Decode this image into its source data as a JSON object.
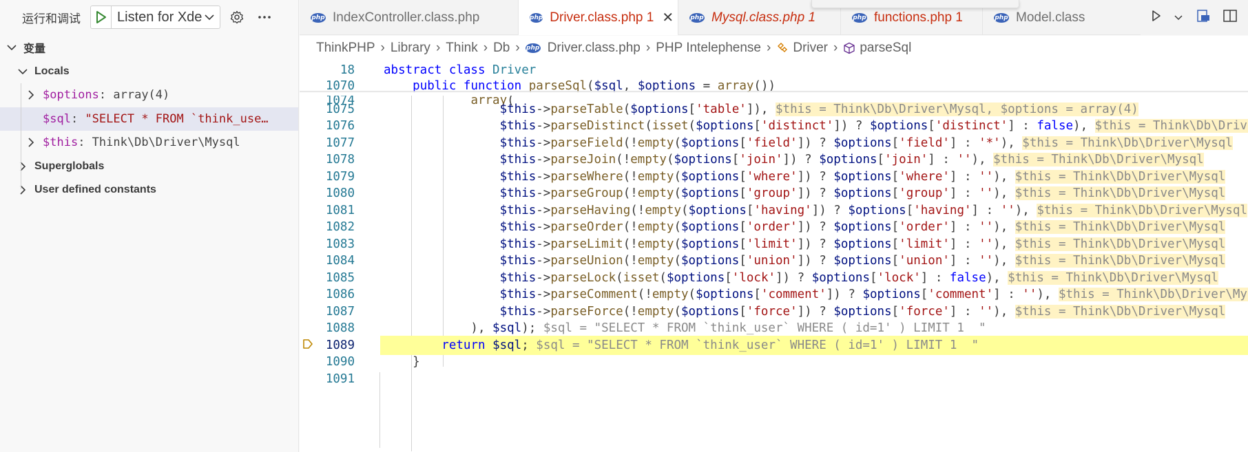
{
  "sidebar": {
    "title": "运行和调试",
    "launch_config": "Listen for Xde",
    "section_title": "变量",
    "locals_label": "Locals",
    "locals": [
      {
        "name": "$options",
        "value": "array(4)"
      },
      {
        "name": "$sql",
        "value": "\"SELECT * FROM `think_use…"
      },
      {
        "name": "$this",
        "value": "Think\\Db\\Driver\\Mysql"
      }
    ],
    "superglobals_label": "Superglobals",
    "user_constants_label": "User defined constants"
  },
  "tabs": [
    {
      "label": "IndexController.class.php"
    },
    {
      "label": "Driver.class.php 1"
    },
    {
      "label": "Mysql.class.php 1"
    },
    {
      "label": "functions.php 1"
    },
    {
      "label": "Model.class"
    }
  ],
  "breadcrumb": [
    "ThinkPHP",
    "Library",
    "Think",
    "Db",
    "Driver.class.php",
    "PHP Intelephense",
    "Driver",
    "parseSql"
  ],
  "editor": {
    "lines": [
      {
        "n": "18",
        "parts": [
          [
            "kw",
            "abstract "
          ],
          [
            "kw",
            "class "
          ],
          [
            "cls",
            "Driver"
          ]
        ]
      },
      {
        "n": "1070",
        "parts": [
          [
            "op",
            "    "
          ],
          [
            "kw",
            "public "
          ],
          [
            "kw",
            "function "
          ],
          [
            "fn",
            "parseSql"
          ],
          [
            "op",
            "("
          ],
          [
            "var",
            "$sql"
          ],
          [
            "op",
            ", "
          ],
          [
            "var",
            "$options"
          ],
          [
            "op",
            " = "
          ],
          [
            "fn",
            "array"
          ],
          [
            "op",
            "())"
          ]
        ]
      },
      {
        "n": "1074",
        "parts": [
          [
            "op",
            "            "
          ],
          [
            "fn",
            "array"
          ],
          [
            "op",
            "("
          ]
        ]
      },
      {
        "n": "1075",
        "parts": [
          [
            "op",
            "                "
          ],
          [
            "var",
            "$this"
          ],
          [
            "op",
            "->"
          ],
          [
            "fn",
            "parseTable"
          ],
          [
            "op",
            "("
          ],
          [
            "var",
            "$options"
          ],
          [
            "op",
            "["
          ],
          [
            "str",
            "'table'"
          ],
          [
            "op",
            "]), "
          ]
        ],
        "inline": "$this = Think\\Db\\Driver\\Mysql, $options = array(4)"
      },
      {
        "n": "1076",
        "parts": [
          [
            "op",
            "                "
          ],
          [
            "var",
            "$this"
          ],
          [
            "op",
            "->"
          ],
          [
            "fn",
            "parseDistinct"
          ],
          [
            "op",
            "("
          ],
          [
            "fn",
            "isset"
          ],
          [
            "op",
            "("
          ],
          [
            "var",
            "$options"
          ],
          [
            "op",
            "["
          ],
          [
            "str",
            "'distinct'"
          ],
          [
            "op",
            "]) ? "
          ],
          [
            "var",
            "$options"
          ],
          [
            "op",
            "["
          ],
          [
            "str",
            "'distinct'"
          ],
          [
            "op",
            "] : "
          ],
          [
            "kw",
            "false"
          ],
          [
            "op",
            "), "
          ]
        ],
        "inline": "$this = Think\\Db\\Driver\\Mysql"
      },
      {
        "n": "1077",
        "parts": [
          [
            "op",
            "                "
          ],
          [
            "var",
            "$this"
          ],
          [
            "op",
            "->"
          ],
          [
            "fn",
            "parseField"
          ],
          [
            "op",
            "(!"
          ],
          [
            "fn",
            "empty"
          ],
          [
            "op",
            "("
          ],
          [
            "var",
            "$options"
          ],
          [
            "op",
            "["
          ],
          [
            "str",
            "'field'"
          ],
          [
            "op",
            "]) ? "
          ],
          [
            "var",
            "$options"
          ],
          [
            "op",
            "["
          ],
          [
            "str",
            "'field'"
          ],
          [
            "op",
            "] : "
          ],
          [
            "str",
            "'*'"
          ],
          [
            "op",
            "), "
          ]
        ],
        "inline": "$this = Think\\Db\\Driver\\Mysql"
      },
      {
        "n": "1078",
        "parts": [
          [
            "op",
            "                "
          ],
          [
            "var",
            "$this"
          ],
          [
            "op",
            "->"
          ],
          [
            "fn",
            "parseJoin"
          ],
          [
            "op",
            "(!"
          ],
          [
            "fn",
            "empty"
          ],
          [
            "op",
            "("
          ],
          [
            "var",
            "$options"
          ],
          [
            "op",
            "["
          ],
          [
            "str",
            "'join'"
          ],
          [
            "op",
            "]) ? "
          ],
          [
            "var",
            "$options"
          ],
          [
            "op",
            "["
          ],
          [
            "str",
            "'join'"
          ],
          [
            "op",
            "] : "
          ],
          [
            "str",
            "''"
          ],
          [
            "op",
            "), "
          ]
        ],
        "inline": "$this = Think\\Db\\Driver\\Mysql"
      },
      {
        "n": "1079",
        "parts": [
          [
            "op",
            "                "
          ],
          [
            "var",
            "$this"
          ],
          [
            "op",
            "->"
          ],
          [
            "fn",
            "parseWhere"
          ],
          [
            "op",
            "(!"
          ],
          [
            "fn",
            "empty"
          ],
          [
            "op",
            "("
          ],
          [
            "var",
            "$options"
          ],
          [
            "op",
            "["
          ],
          [
            "str",
            "'where'"
          ],
          [
            "op",
            "]) ? "
          ],
          [
            "var",
            "$options"
          ],
          [
            "op",
            "["
          ],
          [
            "str",
            "'where'"
          ],
          [
            "op",
            "] : "
          ],
          [
            "str",
            "''"
          ],
          [
            "op",
            "), "
          ]
        ],
        "inline": "$this = Think\\Db\\Driver\\Mysql"
      },
      {
        "n": "1080",
        "parts": [
          [
            "op",
            "                "
          ],
          [
            "var",
            "$this"
          ],
          [
            "op",
            "->"
          ],
          [
            "fn",
            "parseGroup"
          ],
          [
            "op",
            "(!"
          ],
          [
            "fn",
            "empty"
          ],
          [
            "op",
            "("
          ],
          [
            "var",
            "$options"
          ],
          [
            "op",
            "["
          ],
          [
            "str",
            "'group'"
          ],
          [
            "op",
            "]) ? "
          ],
          [
            "var",
            "$options"
          ],
          [
            "op",
            "["
          ],
          [
            "str",
            "'group'"
          ],
          [
            "op",
            "] : "
          ],
          [
            "str",
            "''"
          ],
          [
            "op",
            "), "
          ]
        ],
        "inline": "$this = Think\\Db\\Driver\\Mysql"
      },
      {
        "n": "1081",
        "parts": [
          [
            "op",
            "                "
          ],
          [
            "var",
            "$this"
          ],
          [
            "op",
            "->"
          ],
          [
            "fn",
            "parseHaving"
          ],
          [
            "op",
            "(!"
          ],
          [
            "fn",
            "empty"
          ],
          [
            "op",
            "("
          ],
          [
            "var",
            "$options"
          ],
          [
            "op",
            "["
          ],
          [
            "str",
            "'having'"
          ],
          [
            "op",
            "]) ? "
          ],
          [
            "var",
            "$options"
          ],
          [
            "op",
            "["
          ],
          [
            "str",
            "'having'"
          ],
          [
            "op",
            "] : "
          ],
          [
            "str",
            "''"
          ],
          [
            "op",
            "), "
          ]
        ],
        "inline": "$this = Think\\Db\\Driver\\Mysql"
      },
      {
        "n": "1082",
        "parts": [
          [
            "op",
            "                "
          ],
          [
            "var",
            "$this"
          ],
          [
            "op",
            "->"
          ],
          [
            "fn",
            "parseOrder"
          ],
          [
            "op",
            "(!"
          ],
          [
            "fn",
            "empty"
          ],
          [
            "op",
            "("
          ],
          [
            "var",
            "$options"
          ],
          [
            "op",
            "["
          ],
          [
            "str",
            "'order'"
          ],
          [
            "op",
            "]) ? "
          ],
          [
            "var",
            "$options"
          ],
          [
            "op",
            "["
          ],
          [
            "str",
            "'order'"
          ],
          [
            "op",
            "] : "
          ],
          [
            "str",
            "''"
          ],
          [
            "op",
            "), "
          ]
        ],
        "inline": "$this = Think\\Db\\Driver\\Mysql"
      },
      {
        "n": "1083",
        "parts": [
          [
            "op",
            "                "
          ],
          [
            "var",
            "$this"
          ],
          [
            "op",
            "->"
          ],
          [
            "fn",
            "parseLimit"
          ],
          [
            "op",
            "(!"
          ],
          [
            "fn",
            "empty"
          ],
          [
            "op",
            "("
          ],
          [
            "var",
            "$options"
          ],
          [
            "op",
            "["
          ],
          [
            "str",
            "'limit'"
          ],
          [
            "op",
            "]) ? "
          ],
          [
            "var",
            "$options"
          ],
          [
            "op",
            "["
          ],
          [
            "str",
            "'limit'"
          ],
          [
            "op",
            "] : "
          ],
          [
            "str",
            "''"
          ],
          [
            "op",
            "), "
          ]
        ],
        "inline": "$this = Think\\Db\\Driver\\Mysql"
      },
      {
        "n": "1084",
        "parts": [
          [
            "op",
            "                "
          ],
          [
            "var",
            "$this"
          ],
          [
            "op",
            "->"
          ],
          [
            "fn",
            "parseUnion"
          ],
          [
            "op",
            "(!"
          ],
          [
            "fn",
            "empty"
          ],
          [
            "op",
            "("
          ],
          [
            "var",
            "$options"
          ],
          [
            "op",
            "["
          ],
          [
            "str",
            "'union'"
          ],
          [
            "op",
            "]) ? "
          ],
          [
            "var",
            "$options"
          ],
          [
            "op",
            "["
          ],
          [
            "str",
            "'union'"
          ],
          [
            "op",
            "] : "
          ],
          [
            "str",
            "''"
          ],
          [
            "op",
            "), "
          ]
        ],
        "inline": "$this = Think\\Db\\Driver\\Mysql"
      },
      {
        "n": "1085",
        "parts": [
          [
            "op",
            "                "
          ],
          [
            "var",
            "$this"
          ],
          [
            "op",
            "->"
          ],
          [
            "fn",
            "parseLock"
          ],
          [
            "op",
            "("
          ],
          [
            "fn",
            "isset"
          ],
          [
            "op",
            "("
          ],
          [
            "var",
            "$options"
          ],
          [
            "op",
            "["
          ],
          [
            "str",
            "'lock'"
          ],
          [
            "op",
            "]) ? "
          ],
          [
            "var",
            "$options"
          ],
          [
            "op",
            "["
          ],
          [
            "str",
            "'lock'"
          ],
          [
            "op",
            "] : "
          ],
          [
            "kw",
            "false"
          ],
          [
            "op",
            "), "
          ]
        ],
        "inline": "$this = Think\\Db\\Driver\\Mysql"
      },
      {
        "n": "1086",
        "parts": [
          [
            "op",
            "                "
          ],
          [
            "var",
            "$this"
          ],
          [
            "op",
            "->"
          ],
          [
            "fn",
            "parseComment"
          ],
          [
            "op",
            "(!"
          ],
          [
            "fn",
            "empty"
          ],
          [
            "op",
            "("
          ],
          [
            "var",
            "$options"
          ],
          [
            "op",
            "["
          ],
          [
            "str",
            "'comment'"
          ],
          [
            "op",
            "]) ? "
          ],
          [
            "var",
            "$options"
          ],
          [
            "op",
            "["
          ],
          [
            "str",
            "'comment'"
          ],
          [
            "op",
            "] : "
          ],
          [
            "str",
            "''"
          ],
          [
            "op",
            "), "
          ]
        ],
        "inline": "$this = Think\\Db\\Driver\\Mysql"
      },
      {
        "n": "1087",
        "parts": [
          [
            "op",
            "                "
          ],
          [
            "var",
            "$this"
          ],
          [
            "op",
            "->"
          ],
          [
            "fn",
            "parseForce"
          ],
          [
            "op",
            "(!"
          ],
          [
            "fn",
            "empty"
          ],
          [
            "op",
            "("
          ],
          [
            "var",
            "$options"
          ],
          [
            "op",
            "["
          ],
          [
            "str",
            "'force'"
          ],
          [
            "op",
            "]) ? "
          ],
          [
            "var",
            "$options"
          ],
          [
            "op",
            "["
          ],
          [
            "str",
            "'force'"
          ],
          [
            "op",
            "] : "
          ],
          [
            "str",
            "''"
          ],
          [
            "op",
            "), "
          ]
        ],
        "inline": "$this = Think\\Db\\Driver\\Mysql"
      },
      {
        "n": "1088",
        "parts": [
          [
            "op",
            "            ), "
          ],
          [
            "var",
            "$sql"
          ],
          [
            "op",
            "); "
          ]
        ],
        "inline_plain": "$sql = \"SELECT * FROM `think_user` WHERE ( id=1' ) LIMIT 1  \""
      },
      {
        "n": "1089",
        "parts": [
          [
            "op",
            "        "
          ],
          [
            "kw",
            "return "
          ],
          [
            "var",
            "$sql"
          ],
          [
            "op",
            "; "
          ]
        ],
        "inline_plain": "$sql = \"SELECT * FROM `think_user` WHERE ( id=1' ) LIMIT 1  \"",
        "highlight": true
      },
      {
        "n": "1090",
        "parts": [
          [
            "op",
            "    }"
          ]
        ]
      },
      {
        "n": "1091",
        "parts": []
      }
    ]
  }
}
